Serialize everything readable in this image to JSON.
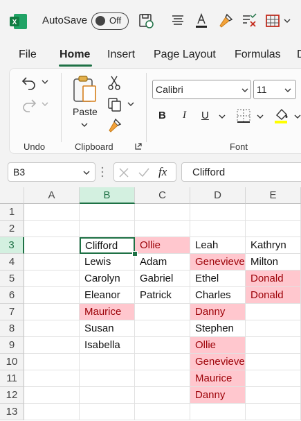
{
  "title_bar": {
    "autosave_label": "AutoSave",
    "toggle_state": "Off",
    "quick_access_icons": [
      "save-sync-icon",
      "align-icon",
      "font-color-icon",
      "format-painter-icon",
      "clear-formats-icon",
      "borders-icon",
      "more-dropdown-icon"
    ]
  },
  "tabs": [
    "File",
    "Home",
    "Insert",
    "Page Layout",
    "Formulas",
    "D"
  ],
  "active_tab": "Home",
  "ribbon": {
    "undo_group_label": "Undo",
    "clipboard_group_label": "Clipboard",
    "paste_label": "Paste",
    "font_group_label": "Font",
    "font_name": "Calibri",
    "font_size": "11",
    "bold": "B",
    "italic": "I",
    "underline": "U",
    "accent_color": "#1e7145",
    "fill_color": "#ffff00"
  },
  "formula_bar": {
    "name_box": "B3",
    "fx": "fx",
    "formula_value": "Clifford"
  },
  "grid": {
    "columns": [
      "A",
      "B",
      "C",
      "D",
      "E"
    ],
    "rows": [
      "1",
      "2",
      "3",
      "4",
      "5",
      "6",
      "7",
      "8",
      "9",
      "10",
      "11",
      "12",
      "13"
    ],
    "selected_cell": "B3",
    "highlight_fill": "#ffc7ce",
    "highlight_text": "#9c0006",
    "cells": {
      "B3": "Clifford",
      "C3": "Ollie",
      "D3": "Leah",
      "E3": "Kathryn",
      "B4": "Lewis",
      "C4": "Adam",
      "D4": "Genevieve",
      "E4": "Milton",
      "B5": "Carolyn",
      "C5": "Gabriel",
      "D5": "Ethel",
      "E5": "Donald",
      "B6": "Eleanor",
      "C6": "Patrick",
      "D6": "Charles",
      "E6": "Donald",
      "B7": "Maurice",
      "D7": "Danny",
      "B8": "Susan",
      "D8": "Stephen",
      "B9": "Isabella",
      "D9": "Ollie",
      "D10": "Genevieve",
      "D11": "Maurice",
      "D12": "Danny"
    },
    "highlighted": [
      "C3",
      "D4",
      "E5",
      "E6",
      "B7",
      "D7",
      "D9",
      "D10",
      "D11",
      "D12"
    ]
  }
}
